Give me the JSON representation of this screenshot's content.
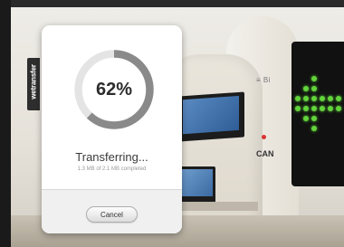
{
  "brand": {
    "name": "wetransfer"
  },
  "transfer": {
    "progress_percent": 62,
    "percent_label": "62%",
    "status": "Transferring...",
    "detail": "1.3 MB of 2.1 MB completed",
    "cancel_label": "Cancel"
  },
  "scene": {
    "sign_top": "≡ Bi",
    "sign_bottom": "CAN"
  },
  "colors": {
    "ring_track": "#e4e4e4",
    "ring_fill": "#8a8a8a",
    "led_green": "#62d33b"
  }
}
